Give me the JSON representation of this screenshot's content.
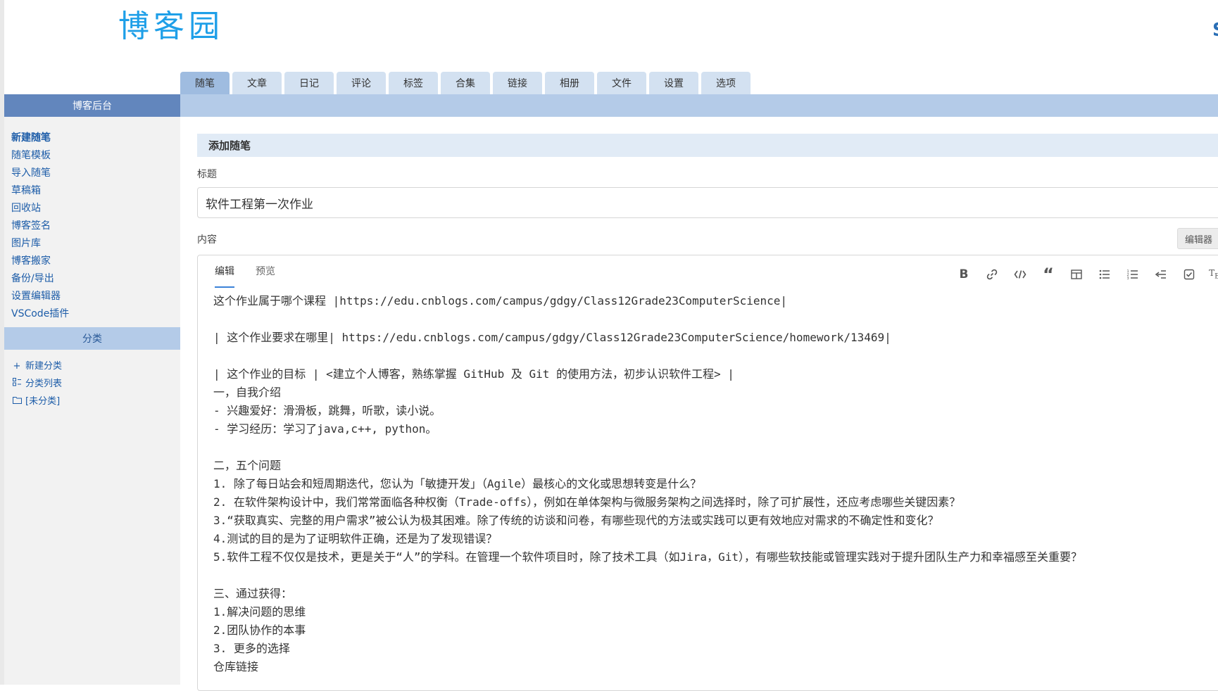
{
  "brand": {
    "logo_text": "博客园",
    "top_right_mark": "S"
  },
  "tabs": [
    "随笔",
    "文章",
    "日记",
    "评论",
    "标签",
    "合集",
    "链接",
    "相册",
    "文件",
    "设置",
    "选项"
  ],
  "active_tab": "随笔",
  "sidebar": {
    "header": "博客后台",
    "links": [
      "新建随笔",
      "随笔模板",
      "导入随笔",
      "草稿箱",
      "回收站",
      "博客签名",
      "图片库",
      "博客搬家",
      "备份/导出",
      "设置编辑器",
      "VSCode插件"
    ],
    "category_header": "分类",
    "category_links": [
      {
        "icon": "plus-icon",
        "label": "新建分类"
      },
      {
        "icon": "list-icon",
        "label": "分类列表"
      },
      {
        "icon": "folder-icon",
        "label": "[未分类]"
      }
    ]
  },
  "form": {
    "section_title": "添加随笔",
    "title_label": "标题",
    "title_value": "软件工程第一次作业",
    "content_label": "内容",
    "editor_switch": "编辑器"
  },
  "editor": {
    "tabs": [
      "编辑",
      "预览"
    ],
    "active_tab": "编辑",
    "toolbar": [
      "bold-icon",
      "link-icon",
      "code-icon",
      "quote-icon",
      "table-icon",
      "bullet-list-icon",
      "numbered-list-icon",
      "indent-icon",
      "checkbox-icon",
      "tex-icon"
    ],
    "lines": [
      "这个作业属于哪个课程 |https://edu.cnblogs.com/campus/gdgy/Class12Grade23ComputerScience|",
      "",
      "| 这个作业要求在哪里| https://edu.cnblogs.com/campus/gdgy/Class12Grade23ComputerScience/homework/13469|",
      "",
      "| 这个作业的目标 | <建立个人博客，熟练掌握 GitHub 及 Git 的使用方法，初步认识软件工程> |",
      "一，自我介绍",
      "- 兴趣爱好：滑滑板，跳舞，听歌，读小说。",
      "- 学习经历：学习了java,c++, python。",
      "",
      "二，五个问题",
      "1. 除了每日站会和短周期迭代，您认为「敏捷开发」（Agile）最核心的文化或思想转变是什么？",
      "2. 在软件架构设计中，我们常常面临各种权衡（Trade-offs），例如在单体架构与微服务架构之间选择时，除了可扩展性，还应考虑哪些关键因素？",
      "3.“获取真实、完整的用户需求”被公认为极其困难。除了传统的访谈和问卷，有哪些现代的方法或实践可以更有效地应对需求的不确定性和变化？",
      "4.测试的目的是为了证明软件正确，还是为了发现错误？",
      "5.软件工程不仅仅是技术，更是关于“人”的学科。在管理一个软件项目时，除了技术工具（如Jira，Git），有哪些软技能或管理实践对于提升团队生产力和幸福感至关重要？",
      "",
      "三、通过获得：",
      "1.解决问题的思维",
      "2.团队协作的本事",
      "3. 更多的选择",
      "仓库链接"
    ]
  }
}
